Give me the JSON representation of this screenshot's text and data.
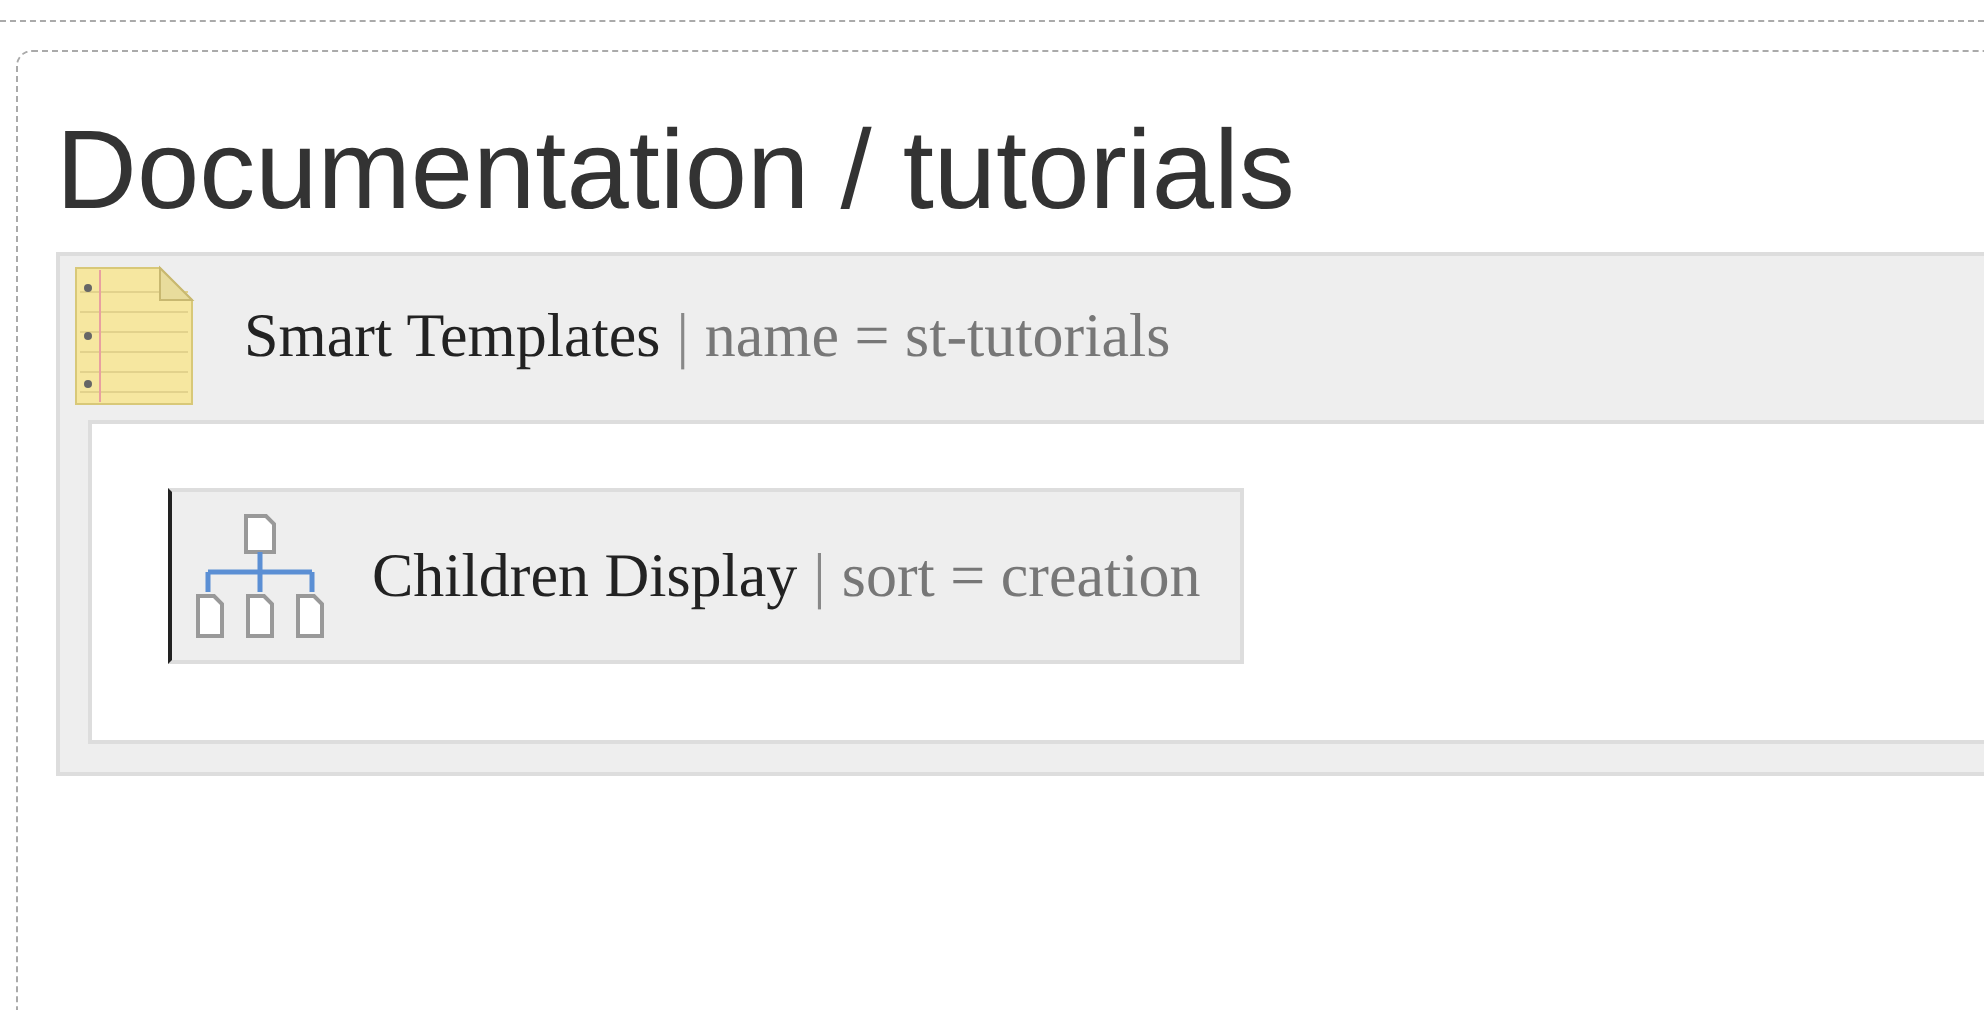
{
  "heading": "Documentation / tutorials",
  "macro": {
    "kind": "smart-templates",
    "title": "Smart Templates",
    "separator": "|",
    "params": "name = st-tutorials",
    "children": [
      {
        "kind": "children-display",
        "title": "Children Display",
        "separator": "|",
        "params": "sort = creation"
      }
    ]
  }
}
